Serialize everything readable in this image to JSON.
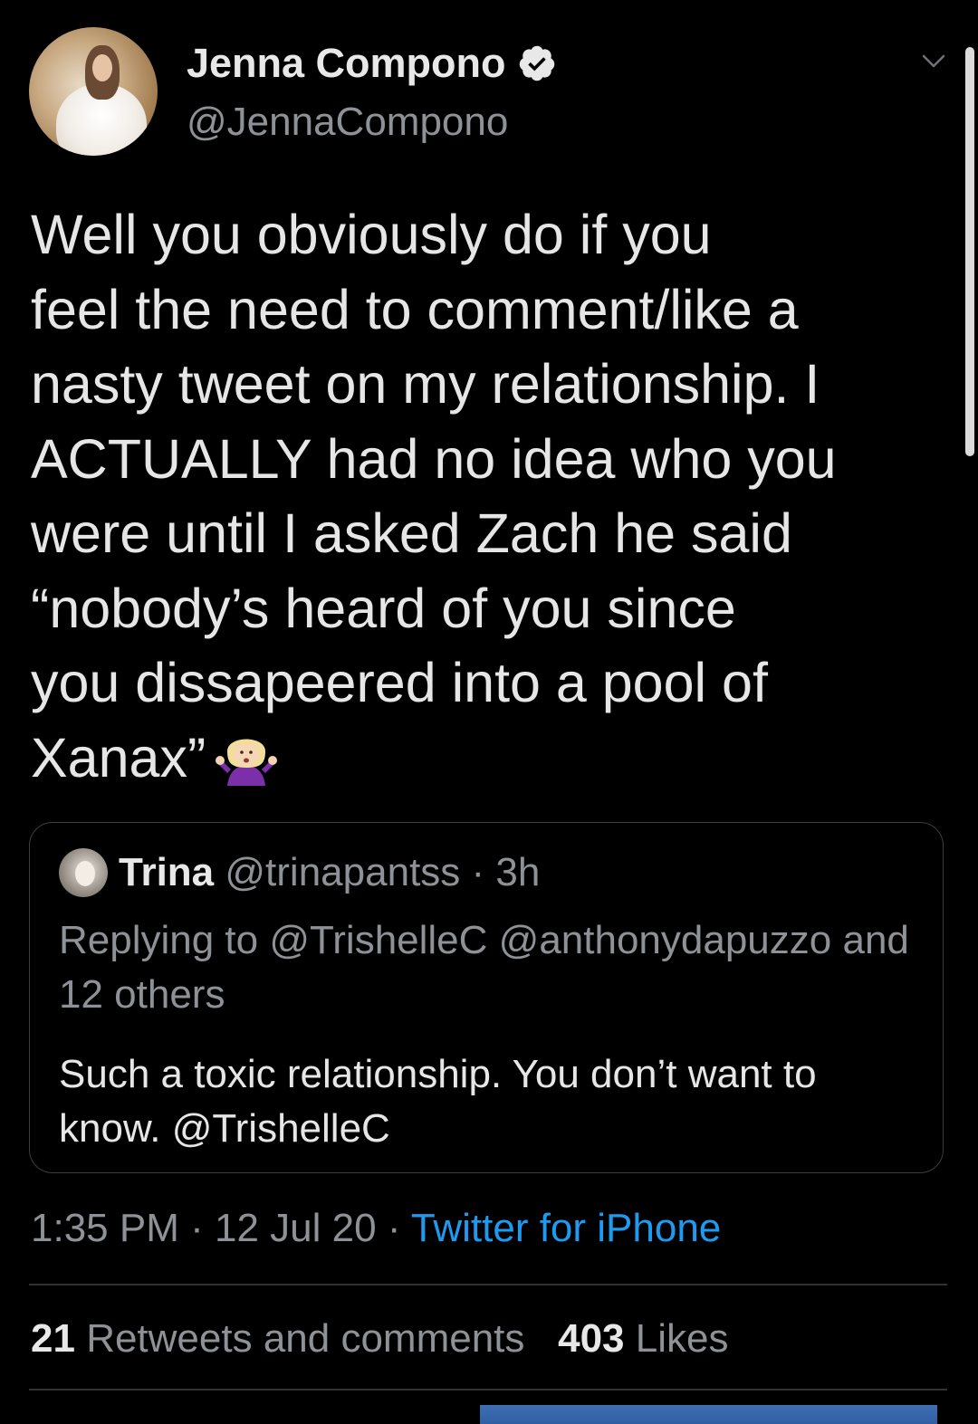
{
  "tweet": {
    "author_name": "Jenna Compono",
    "author_handle": "@JennaCompono",
    "text": "Well you obviously do if you\nfeel the need to comment/like a\nnasty tweet on my relationship. I\nACTUALLY had no idea who you\nwere until I asked Zach he said\n“nobody’s heard of you since\nyou dissapeered into a pool of\nXanax”",
    "emoji_icon": "person-shrugging-emoji-icon",
    "time": "1:35 PM",
    "separator": "·",
    "date": "12 Jul 20",
    "source": "Twitter for iPhone",
    "retweets_count": "21",
    "retweets_label": "Retweets and comments",
    "likes_count": "403",
    "likes_label": "Likes"
  },
  "quoted": {
    "name": "Trina",
    "handle": "@trinapantss",
    "separator": "·",
    "age": "3h",
    "replying_to": "Replying to @TrishelleC @anthonydapuzzo and 12 others",
    "text": "Such a toxic relationship. You don’t want to know. @TrishelleC"
  },
  "colors": {
    "background": "#000000",
    "link": "#1d9bf0",
    "secondary_text": "#8e9297",
    "primary_text": "#e6e6e6"
  }
}
